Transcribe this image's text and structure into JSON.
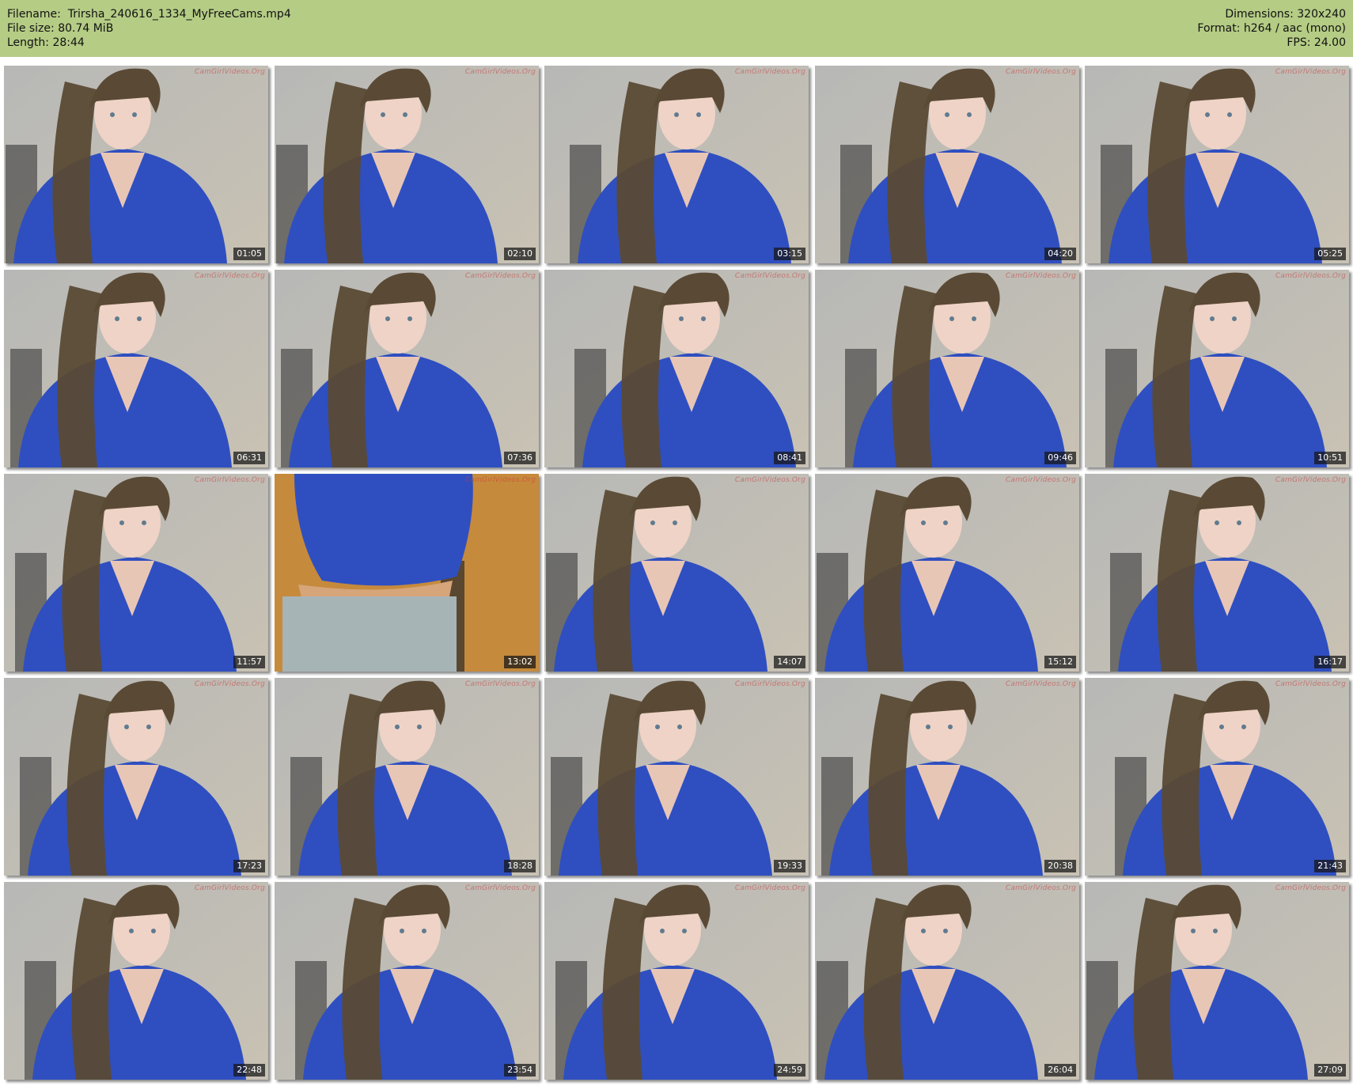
{
  "header": {
    "filename_label": "Filename:",
    "filename": "Trirsha_240616_1334_MyFreeCams.mp4",
    "filesize_label": "File size:",
    "filesize": "80.74 MiB",
    "length_label": "Length:",
    "length": "28:44",
    "dimensions_label": "Dimensions:",
    "dimensions": "320x240",
    "format_label": "Format:",
    "format": "h264 / aac (mono)",
    "fps_label": "FPS:",
    "fps": "24.00"
  },
  "watermark": "CamGirlVideos.Org",
  "thumbnails": [
    {
      "time": "01:05"
    },
    {
      "time": "02:10"
    },
    {
      "time": "03:15"
    },
    {
      "time": "04:20"
    },
    {
      "time": "05:25"
    },
    {
      "time": "06:31"
    },
    {
      "time": "07:36"
    },
    {
      "time": "08:41"
    },
    {
      "time": "09:46"
    },
    {
      "time": "10:51"
    },
    {
      "time": "11:57"
    },
    {
      "time": "13:02"
    },
    {
      "time": "14:07"
    },
    {
      "time": "15:12"
    },
    {
      "time": "16:17"
    },
    {
      "time": "17:23"
    },
    {
      "time": "18:28"
    },
    {
      "time": "19:33"
    },
    {
      "time": "20:38"
    },
    {
      "time": "21:43"
    },
    {
      "time": "22:48"
    },
    {
      "time": "23:54"
    },
    {
      "time": "24:59"
    },
    {
      "time": "26:04"
    },
    {
      "time": "27:09"
    }
  ],
  "colors": {
    "header_bg": "#b5cc85",
    "shirt": "#2f4fc0",
    "wall": "#c9c2b4",
    "hair": "#5a4a35"
  }
}
